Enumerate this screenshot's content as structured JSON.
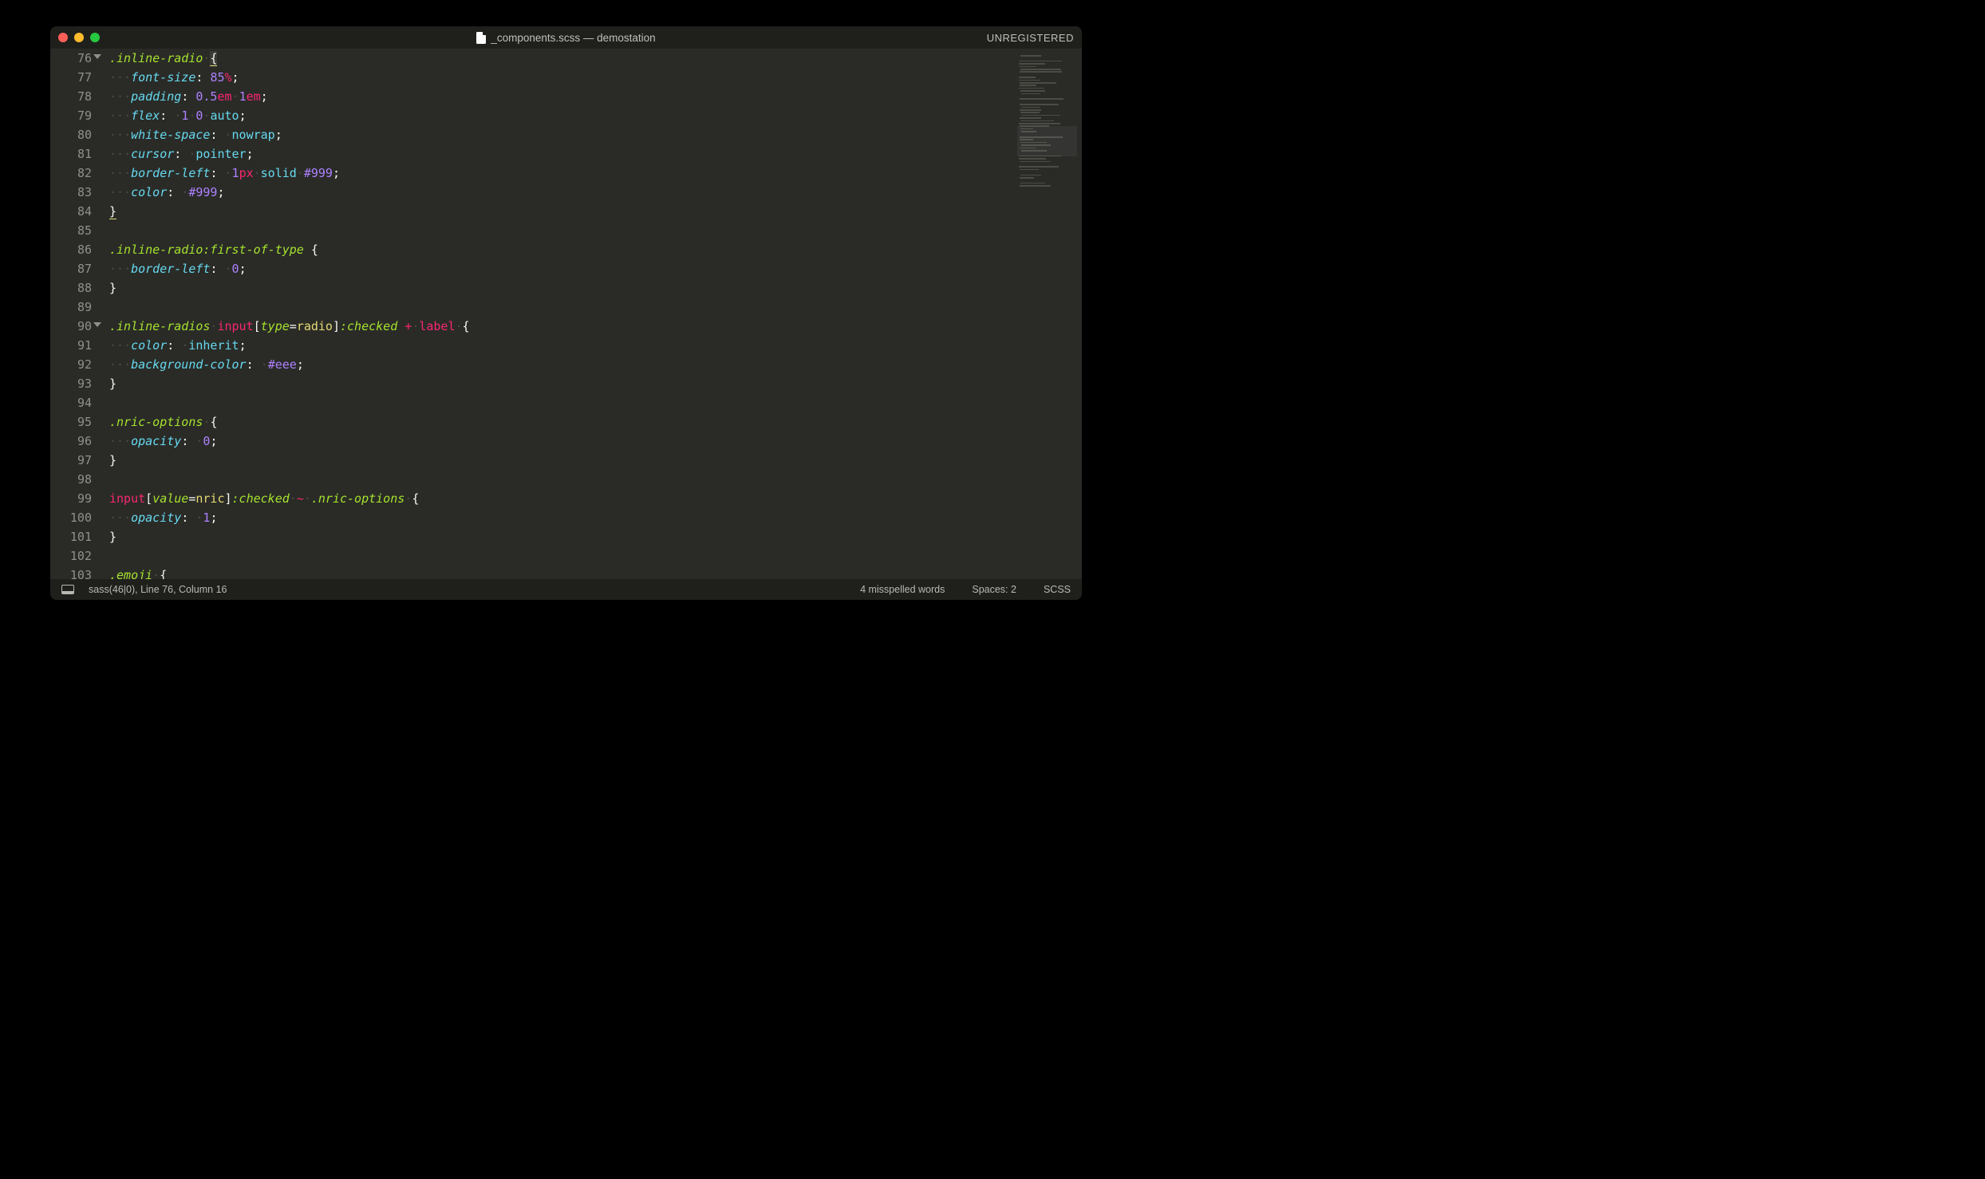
{
  "window": {
    "title": "_components.scss — demostation",
    "registration": "UNREGISTERED"
  },
  "gutter": {
    "start": 76,
    "count": 28,
    "folds": [
      76,
      90
    ],
    "dots": [
      80,
      82,
      83,
      92,
      100
    ]
  },
  "code_lines": [
    [
      {
        "t": ".inline-radio",
        "c": "sel"
      },
      {
        "t": "·",
        "c": "invis"
      },
      {
        "t": "{",
        "c": "punct brack-underline brack-open"
      }
    ],
    [
      {
        "t": "··",
        "c": "invis"
      },
      {
        "t": "·",
        "c": "invis"
      },
      {
        "t": "font-size",
        "c": "prop"
      },
      {
        "t": ": ",
        "c": "punct"
      },
      {
        "t": "85",
        "c": "num"
      },
      {
        "t": "%",
        "c": "unit"
      },
      {
        "t": ";",
        "c": "punct"
      }
    ],
    [
      {
        "t": "··",
        "c": "invis"
      },
      {
        "t": "·",
        "c": "invis"
      },
      {
        "t": "padding",
        "c": "prop"
      },
      {
        "t": ": ",
        "c": "punct"
      },
      {
        "t": "0.5",
        "c": "num"
      },
      {
        "t": "em",
        "c": "unit"
      },
      {
        "t": "·",
        "c": "invis"
      },
      {
        "t": "1",
        "c": "num"
      },
      {
        "t": "em",
        "c": "unit"
      },
      {
        "t": ";",
        "c": "punct"
      }
    ],
    [
      {
        "t": "··",
        "c": "invis"
      },
      {
        "t": "·",
        "c": "invis"
      },
      {
        "t": "flex",
        "c": "prop"
      },
      {
        "t": ": ",
        "c": "punct"
      },
      {
        "t": "·",
        "c": "invis"
      },
      {
        "t": "1",
        "c": "num"
      },
      {
        "t": "·",
        "c": "invis"
      },
      {
        "t": "0",
        "c": "num"
      },
      {
        "t": "·",
        "c": "invis"
      },
      {
        "t": "auto",
        "c": "kw"
      },
      {
        "t": ";",
        "c": "punct"
      }
    ],
    [
      {
        "t": "··",
        "c": "invis"
      },
      {
        "t": "·",
        "c": "invis"
      },
      {
        "t": "white-space",
        "c": "prop"
      },
      {
        "t": ": ",
        "c": "punct"
      },
      {
        "t": "·",
        "c": "invis"
      },
      {
        "t": "nowrap",
        "c": "kw"
      },
      {
        "t": ";",
        "c": "punct"
      }
    ],
    [
      {
        "t": "··",
        "c": "invis"
      },
      {
        "t": "·",
        "c": "invis"
      },
      {
        "t": "cursor",
        "c": "prop"
      },
      {
        "t": ": ",
        "c": "punct"
      },
      {
        "t": "·",
        "c": "invis"
      },
      {
        "t": "pointer",
        "c": "kw"
      },
      {
        "t": ";",
        "c": "punct"
      }
    ],
    [
      {
        "t": "··",
        "c": "invis"
      },
      {
        "t": "·",
        "c": "invis"
      },
      {
        "t": "border-left",
        "c": "prop"
      },
      {
        "t": ": ",
        "c": "punct"
      },
      {
        "t": "·",
        "c": "invis"
      },
      {
        "t": "1",
        "c": "num"
      },
      {
        "t": "px",
        "c": "unit"
      },
      {
        "t": "·",
        "c": "invis"
      },
      {
        "t": "solid",
        "c": "kw"
      },
      {
        "t": "·",
        "c": "invis"
      },
      {
        "t": "#",
        "c": "num"
      },
      {
        "t": "999",
        "c": "num"
      },
      {
        "t": ";",
        "c": "punct"
      }
    ],
    [
      {
        "t": "··",
        "c": "invis"
      },
      {
        "t": "·",
        "c": "invis"
      },
      {
        "t": "color",
        "c": "prop"
      },
      {
        "t": ": ",
        "c": "punct"
      },
      {
        "t": "·",
        "c": "invis"
      },
      {
        "t": "#",
        "c": "num"
      },
      {
        "t": "999",
        "c": "num"
      },
      {
        "t": ";",
        "c": "punct"
      }
    ],
    [
      {
        "t": "}",
        "c": "punct brack-close"
      }
    ],
    [],
    [
      {
        "t": ".inline-radio",
        "c": "sel"
      },
      {
        "t": ":first-of-type",
        "c": "pseudo"
      },
      {
        "t": " {",
        "c": "punct"
      }
    ],
    [
      {
        "t": "··",
        "c": "invis"
      },
      {
        "t": "·",
        "c": "invis"
      },
      {
        "t": "border-left",
        "c": "prop"
      },
      {
        "t": ": ",
        "c": "punct"
      },
      {
        "t": "·",
        "c": "invis"
      },
      {
        "t": "0",
        "c": "num"
      },
      {
        "t": ";",
        "c": "punct"
      }
    ],
    [
      {
        "t": "}",
        "c": "punct"
      }
    ],
    [],
    [
      {
        "t": ".inline-radios",
        "c": "sel"
      },
      {
        "t": "·",
        "c": "invis"
      },
      {
        "t": "input",
        "c": "tag"
      },
      {
        "t": "[",
        "c": "punct"
      },
      {
        "t": "type",
        "c": "attr"
      },
      {
        "t": "=",
        "c": "punct"
      },
      {
        "t": "radio",
        "c": "str"
      },
      {
        "t": "]",
        "c": "punct"
      },
      {
        "t": ":checked",
        "c": "pseudo"
      },
      {
        "t": " ",
        "c": "punct"
      },
      {
        "t": "+",
        "c": "plus"
      },
      {
        "t": "·",
        "c": "invis"
      },
      {
        "t": "label",
        "c": "label-sel"
      },
      {
        "t": "·",
        "c": "invis"
      },
      {
        "t": "{",
        "c": "punct"
      }
    ],
    [
      {
        "t": "··",
        "c": "invis"
      },
      {
        "t": "·",
        "c": "invis"
      },
      {
        "t": "color",
        "c": "prop"
      },
      {
        "t": ": ",
        "c": "punct"
      },
      {
        "t": "·",
        "c": "invis"
      },
      {
        "t": "inherit",
        "c": "kw"
      },
      {
        "t": ";",
        "c": "punct"
      }
    ],
    [
      {
        "t": "··",
        "c": "invis"
      },
      {
        "t": "·",
        "c": "invis"
      },
      {
        "t": "background-color",
        "c": "prop"
      },
      {
        "t": ": ",
        "c": "punct"
      },
      {
        "t": "·",
        "c": "invis"
      },
      {
        "t": "#",
        "c": "num"
      },
      {
        "t": "eee",
        "c": "num"
      },
      {
        "t": ";",
        "c": "punct"
      }
    ],
    [
      {
        "t": "}",
        "c": "punct"
      }
    ],
    [],
    [
      {
        "t": ".nric-options",
        "c": "sel"
      },
      {
        "t": "·",
        "c": "invis"
      },
      {
        "t": "{",
        "c": "punct"
      }
    ],
    [
      {
        "t": "··",
        "c": "invis"
      },
      {
        "t": "·",
        "c": "invis"
      },
      {
        "t": "opacity",
        "c": "prop"
      },
      {
        "t": ": ",
        "c": "punct"
      },
      {
        "t": "·",
        "c": "invis"
      },
      {
        "t": "0",
        "c": "num"
      },
      {
        "t": ";",
        "c": "punct"
      }
    ],
    [
      {
        "t": "}",
        "c": "punct"
      }
    ],
    [],
    [
      {
        "t": "input",
        "c": "tag"
      },
      {
        "t": "[",
        "c": "punct"
      },
      {
        "t": "value",
        "c": "attr"
      },
      {
        "t": "=",
        "c": "punct"
      },
      {
        "t": "nric",
        "c": "str"
      },
      {
        "t": "]",
        "c": "punct"
      },
      {
        "t": ":checked",
        "c": "pseudo"
      },
      {
        "t": "·",
        "c": "invis"
      },
      {
        "t": "~",
        "c": "plus"
      },
      {
        "t": "·",
        "c": "invis"
      },
      {
        "t": ".nric-options",
        "c": "sel"
      },
      {
        "t": "·",
        "c": "invis"
      },
      {
        "t": "{",
        "c": "punct"
      }
    ],
    [
      {
        "t": "··",
        "c": "invis"
      },
      {
        "t": "·",
        "c": "invis"
      },
      {
        "t": "opacity",
        "c": "prop"
      },
      {
        "t": ": ",
        "c": "punct"
      },
      {
        "t": "·",
        "c": "invis"
      },
      {
        "t": "1",
        "c": "num"
      },
      {
        "t": ";",
        "c": "punct"
      }
    ],
    [
      {
        "t": "}",
        "c": "punct"
      }
    ],
    [],
    [
      {
        "t": ".emoji",
        "c": "sel"
      },
      {
        "t": "·",
        "c": "invis"
      },
      {
        "t": "{",
        "c": "punct"
      }
    ]
  ],
  "statusbar": {
    "left": "sass(46|0), Line 76, Column 16",
    "spell": "4 misspelled words",
    "spaces": "Spaces: 2",
    "syntax": "SCSS"
  }
}
